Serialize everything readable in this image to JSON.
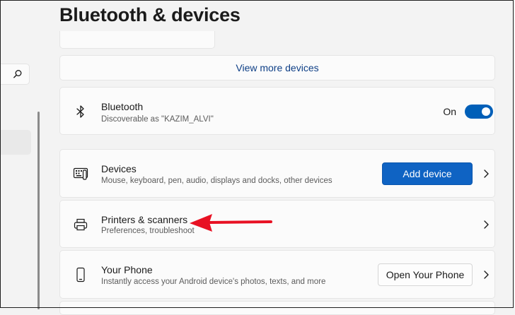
{
  "page": {
    "title": "Bluetooth & devices"
  },
  "nav": {
    "search_icon": "search-icon"
  },
  "view_more": {
    "label": "View more devices"
  },
  "bluetooth": {
    "title": "Bluetooth",
    "subtitle": "Discoverable as \"KAZIM_ALVI\"",
    "toggle_label": "On",
    "toggle_on": true,
    "icon": "bluetooth-icon"
  },
  "devices": {
    "title": "Devices",
    "subtitle": "Mouse, keyboard, pen, audio, displays and docks, other devices",
    "button_label": "Add device",
    "icon": "keyboard-device-icon"
  },
  "printers": {
    "title": "Printers & scanners",
    "subtitle": "Preferences, troubleshoot",
    "icon": "printer-icon"
  },
  "phone": {
    "title": "Your Phone",
    "subtitle": "Instantly access your Android device's photos, texts, and more",
    "button_label": "Open Your Phone",
    "icon": "phone-icon"
  },
  "colors": {
    "accent": "#0f63c3",
    "toggle": "#005fb8",
    "annotation_arrow": "#e81123"
  }
}
